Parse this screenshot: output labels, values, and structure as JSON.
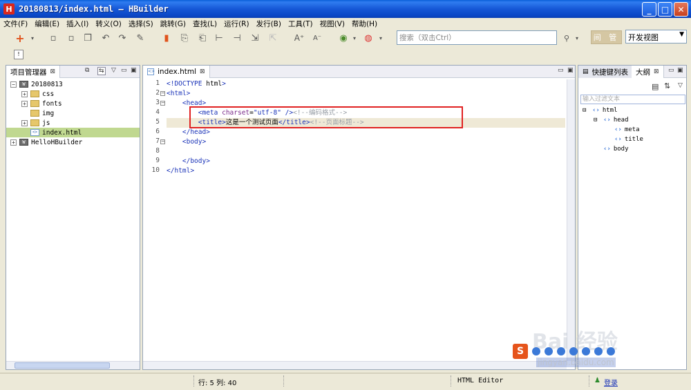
{
  "window": {
    "app_icon": "H",
    "title": "20180813/index.html — HBuilder"
  },
  "menu": [
    "文件(F)",
    "编辑(E)",
    "插入(I)",
    "转义(O)",
    "选择(S)",
    "跳转(G)",
    "查找(L)",
    "运行(R)",
    "发行(B)",
    "工具(T)",
    "视图(V)",
    "帮助(H)"
  ],
  "toolbar": {
    "search_placeholder": "搜索（双击Ctrl）",
    "search_btn": "🔍",
    "jianguan_label": "间 管",
    "view_select": "开发视图"
  },
  "project_panel": {
    "tab_label": "项目管理器",
    "tree": [
      {
        "label": "20180813",
        "type": "project",
        "expanded": true,
        "depth": 0
      },
      {
        "label": "css",
        "type": "folder",
        "expanded": false,
        "depth": 1
      },
      {
        "label": "fonts",
        "type": "folder",
        "expanded": false,
        "depth": 1
      },
      {
        "label": "img",
        "type": "folder",
        "expanded": null,
        "depth": 1
      },
      {
        "label": "js",
        "type": "folder",
        "expanded": false,
        "depth": 1
      },
      {
        "label": "index.html",
        "type": "html",
        "expanded": null,
        "depth": 1,
        "selected": true
      },
      {
        "label": "HelloHBuilder",
        "type": "project",
        "expanded": false,
        "depth": 0
      }
    ]
  },
  "editor": {
    "tab_label": "index.html",
    "current_line": 5,
    "lines": [
      {
        "n": "1",
        "html": "<span class='tag'>&lt;!DOCTYPE</span> <span class='text'>html</span><span class='tag'>&gt;</span>"
      },
      {
        "n": "2",
        "html": "<span class='tag'>&lt;html&gt;</span>"
      },
      {
        "n": "3",
        "html": "    <span class='tag'>&lt;head&gt;</span>"
      },
      {
        "n": "4",
        "html": "        <span class='tag'>&lt;meta</span> <span class='attr'>charset</span>=<span class='str'>\"utf-8\"</span> <span class='tag'>/&gt;</span><span class='cmt'>&lt;!--编码格式--&gt;</span>"
      },
      {
        "n": "5",
        "html": "        <span class='tag'>&lt;title&gt;</span><span class='text'>这是一个测试页面</span><span class='tag'>&lt;/title&gt;</span><span class='cmt'>&lt;!--页面标题--&gt;</span>"
      },
      {
        "n": "6",
        "html": "    <span class='tag'>&lt;/head&gt;</span>"
      },
      {
        "n": "7",
        "html": "    <span class='tag'>&lt;body&gt;</span>"
      },
      {
        "n": "8",
        "html": ""
      },
      {
        "n": "9",
        "html": "    <span class='tag'>&lt;/body&gt;</span>"
      },
      {
        "n": "10",
        "html": "<span class='tag'>&lt;/html&gt;</span>"
      }
    ]
  },
  "outline_panel": {
    "tab_shortcuts": "快捷键列表",
    "tab_outline": "大纲",
    "filter_placeholder": "输入过滤文本",
    "nodes": [
      {
        "label": "html",
        "depth": 0,
        "expander": "⊟"
      },
      {
        "label": "head",
        "depth": 1,
        "expander": "⊟"
      },
      {
        "label": "meta",
        "depth": 2,
        "expander": ""
      },
      {
        "label": "title",
        "depth": 2,
        "expander": ""
      },
      {
        "label": "body",
        "depth": 1,
        "expander": ""
      }
    ]
  },
  "status": {
    "position": "行: 5 列: 40",
    "editor_type": "HTML Editor",
    "login": "登录"
  },
  "watermark": {
    "logo": "Bai 经验",
    "url": "jingyan.baidu.com",
    "s": "S"
  }
}
